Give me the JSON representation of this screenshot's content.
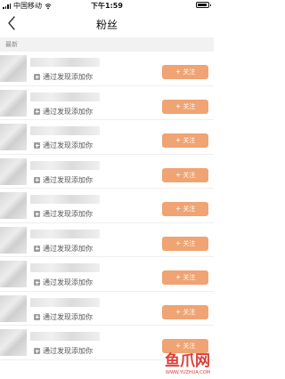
{
  "status_bar": {
    "carrier": "中国移动",
    "time": "下午1:59"
  },
  "nav": {
    "title": "粉丝"
  },
  "section": {
    "label": "最新"
  },
  "fans": [
    {
      "source": "通过发现添加你",
      "follow_label": "关注"
    },
    {
      "source": "通过发现添加你",
      "follow_label": "关注"
    },
    {
      "source": "通过发现添加你",
      "follow_label": "关注"
    },
    {
      "source": "通过发现添加你",
      "follow_label": "关注"
    },
    {
      "source": "通过发现添加你",
      "follow_label": "关注"
    },
    {
      "source": "通过发现添加你",
      "follow_label": "关注"
    },
    {
      "source": "通过发现添加你",
      "follow_label": "关注"
    },
    {
      "source": "通过发现添加你",
      "follow_label": "关注"
    },
    {
      "source": "通过发现添加你",
      "follow_label": "关注"
    }
  ],
  "follow_button_color": "#f0a373",
  "watermark": {
    "logo": "鱼爪网",
    "url": "WWW.YUZHUA.COM"
  }
}
